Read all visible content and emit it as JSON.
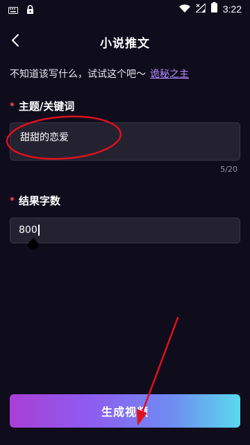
{
  "status_bar": {
    "time": "3:22",
    "icons": [
      "keyboard-icon",
      "lock-icon",
      "wifi-icon",
      "signal-icon",
      "battery-icon"
    ]
  },
  "header": {
    "title": "小说推文",
    "back_icon": "chevron-left-icon"
  },
  "hint": {
    "text": "不知道该写什么，试试这个吧～",
    "link_text": "诡秘之主"
  },
  "topic_field": {
    "label": "主题/关键词",
    "required_mark": "*",
    "value": "甜甜的恋爱",
    "counter": "5/20"
  },
  "word_count_field": {
    "label": "结果字数",
    "required_mark": "*",
    "value": "800"
  },
  "generate_button": {
    "label": "生成视频"
  },
  "colors": {
    "background": "#0f0c1c",
    "field_background": "#242230",
    "link": "#b48cff",
    "required": "#ff4d4f",
    "annotation": "#e0101e",
    "button_gradient_start": "#a93fd6",
    "button_gradient_end": "#5ad9ee"
  }
}
